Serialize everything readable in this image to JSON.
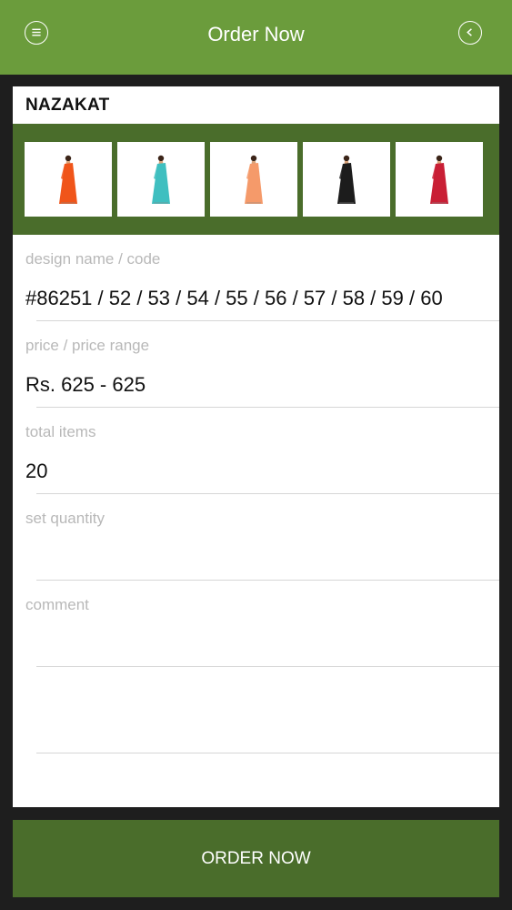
{
  "header": {
    "title": "Order Now",
    "menu_icon": "menu-icon",
    "back_icon": "chevron-left-icon"
  },
  "product": {
    "brand": "NAZAKAT",
    "thumbnails": [
      {
        "name": "saree-orange",
        "color": "#f0551a"
      },
      {
        "name": "saree-teal",
        "color": "#3fbfc0"
      },
      {
        "name": "saree-peach",
        "color": "#f59a6a"
      },
      {
        "name": "saree-black",
        "color": "#1c1c1c"
      },
      {
        "name": "saree-red",
        "color": "#c91f35"
      }
    ]
  },
  "form": {
    "design_label": "design name / code",
    "design_value": "#86251 / 52 / 53 / 54 / 55 / 56 / 57 / 58 / 59 / 60",
    "price_label": "price / price range",
    "price_value": "Rs. 625 - 625",
    "total_label": "total items",
    "total_value": "20",
    "set_label": "set quantity",
    "set_value": "",
    "comment_label": "comment",
    "comment_value": ""
  },
  "footer": {
    "order_label": "ORDER NOW"
  },
  "colors": {
    "header": "#6b9c3c",
    "dark_green": "#4a6d2b",
    "background": "#1e1e1e"
  }
}
